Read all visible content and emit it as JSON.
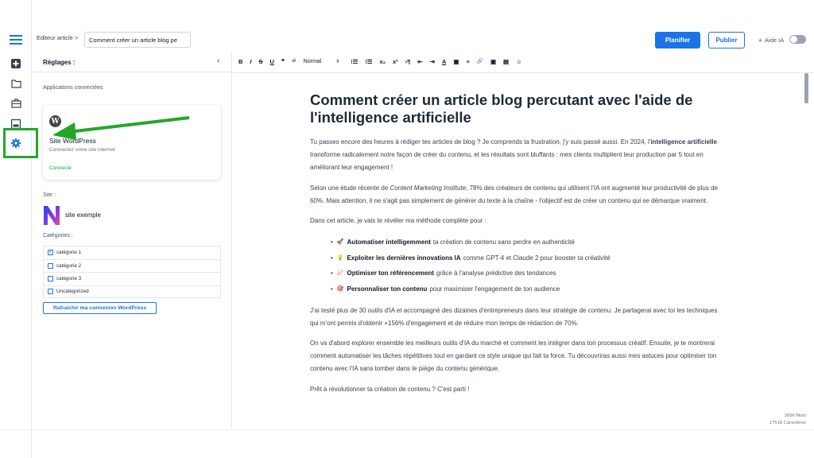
{
  "header": {
    "breadcrumb": "Editeur article >",
    "title_input": "Comment créer un article blog pe",
    "plan_label": "Planifier",
    "publish_label": "Publier",
    "ai_toggle_label": "Aide IA",
    "ai_toggle_on": false
  },
  "settings": {
    "title": "Réglages :",
    "connected_apps_label": "Applications connectées",
    "wordpress": {
      "name": "Site WordPress",
      "description": "Connectez votre site internet",
      "status": "Connecté"
    },
    "site_label": "Site :",
    "site_name": "site exemple",
    "categories_label": "Catégories :",
    "categories": [
      {
        "label": "catégorie 1",
        "checked": true
      },
      {
        "label": "catégorie 2",
        "checked": false
      },
      {
        "label": "catégorie 3",
        "checked": false
      },
      {
        "label": "Uncategorized",
        "checked": false
      }
    ],
    "refresh_label": "Rafraichir ma connexion WordPress"
  },
  "toolbar": {
    "bold": "B",
    "italic": "I",
    "strike": "S",
    "underline": "U",
    "quote": "❞",
    "code": "‹/›",
    "format": "Normal",
    "items": [
      "⁝☰",
      "⁝☰",
      "x₂",
      "x²",
      "›¶",
      "⇤",
      "⇥",
      "A",
      "▣",
      "≡",
      "🔗",
      "▣",
      "▤",
      "☺"
    ]
  },
  "article": {
    "title": "Comment créer un article blog percutant avec l'aide de l'intelligence artificielle",
    "p1_a": "Tu passes encore des heures à rédiger tes articles de blog ? Je comprends ta frustration, j'y suis passé aussi. En 2024, l'",
    "p1_b": "intelligence artificielle",
    "p1_c": " transforme radicalement notre façon de créer du contenu, et les résultats sont bluffants : mes clients multiplient leur production par 5 tout en améliorant leur engagement !",
    "p2_a": "Selon une étude récente de ",
    "p2_b": "Content Marketing Institute",
    "p2_c": ", 78% des créateurs de contenu qui utilisent l'IA ont augmenté leur productivité de plus de 60%. Mais attention, il ne s'agit pas simplement de générer du texte à la chaîne - l'objectif est de créer un contenu qui se démarque vraiment.",
    "p3": "Dans cet article, je vais te révéler ma méthode complète pour :",
    "bullets": [
      {
        "emoji": "🚀",
        "bold": "Automatiser intelligemment",
        "text": "ta création de contenu sans perdre en authenticité"
      },
      {
        "emoji": "💡",
        "bold": "Exploiter les dernières innovations IA",
        "text": "comme GPT-4 et Claude 2 pour booster ta créativité"
      },
      {
        "emoji": "📈",
        "bold": "Optimiser ton référencement",
        "text": "grâce à l'analyse prédictive des tendances"
      },
      {
        "emoji": "🎯",
        "bold": "Personnaliser ton contenu",
        "text": "pour maximiser l'engagement de ton audience"
      }
    ],
    "p4": "J'ai testé plus de 30 outils d'IA et accompagné des dizaines d'entrepreneurs dans leur stratégie de contenu. Je partagerai avec toi les techniques qui m'ont permis d'obtenir +156% d'engagement et de réduire mon temps de rédaction de 70%.",
    "p5": "On va d'abord explorer ensemble les meilleurs outils d'IA du marché et comment les intégrer dans ton processus créatif. Ensuite, je te montrerai comment automatiser les tâches répétitives tout en gardant ce style unique qui fait ta force. Tu découvriras aussi mes astuces pour optimiser ton contenu avec l'IA sans tomber dans le piège du contenu générique.",
    "p6": "Prêt à révolutionner ta création de contenu ? C'est parti !"
  },
  "stats": {
    "words": "2696 Mots",
    "chars": "17518 Caractères"
  },
  "colors": {
    "accent": "#1a73e8",
    "highlight": "#22a728",
    "connected": "#16a34a"
  },
  "icons": {
    "rail": [
      "menu-icon",
      "add-icon",
      "folder-icon",
      "briefcase-icon",
      "image-icon",
      "settings-icon"
    ]
  }
}
